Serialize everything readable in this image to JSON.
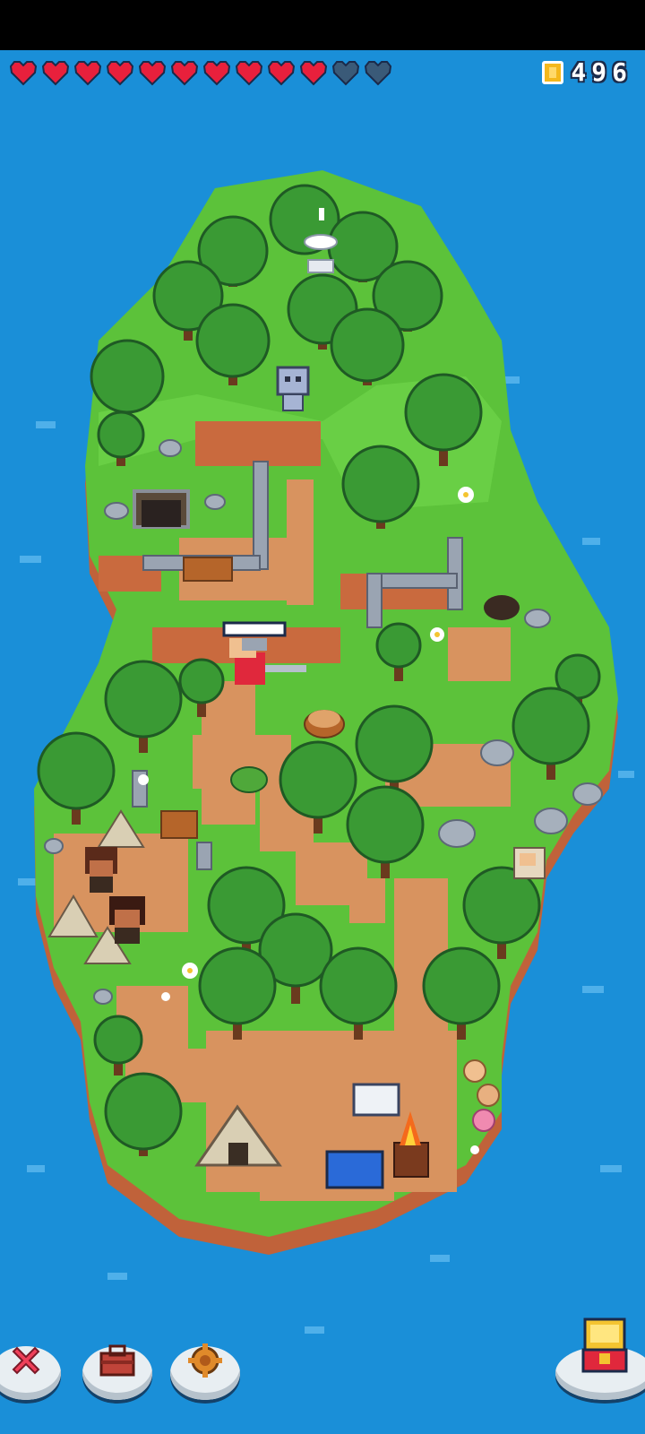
{
  "hud": {
    "hearts": {
      "total": 12,
      "filled": 10,
      "full_color": "#e8203c",
      "empty_color": "#3a5a78"
    },
    "coins": {
      "count": "496",
      "icon": "gold-coin-icon"
    }
  },
  "toolbar": {
    "left_buttons": [
      {
        "name": "close-button",
        "icon": "red-x-icon"
      },
      {
        "name": "inventory-button",
        "icon": "toolbox-icon"
      },
      {
        "name": "settings-button",
        "icon": "gear-icon"
      }
    ],
    "right_buttons": [
      {
        "name": "treasure-chest-button",
        "icon": "treasure-chest-icon"
      }
    ]
  },
  "colors": {
    "ocean": "#1a8fd8",
    "grass": "#5cc23a",
    "dirt_path": "#d8935f",
    "cliff": "#c0623a",
    "tree": "#3a9a34"
  }
}
